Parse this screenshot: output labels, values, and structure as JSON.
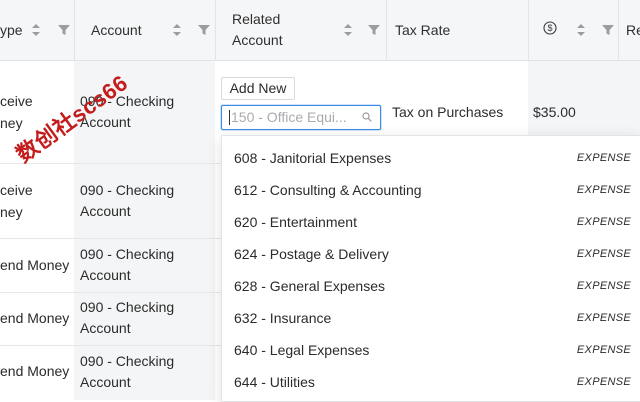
{
  "header": {
    "columns": [
      {
        "label": "ype"
      },
      {
        "label": "Account"
      },
      {
        "label": "Related\nAccount"
      },
      {
        "label": "Tax Rate"
      },
      {
        "label": "$"
      },
      {
        "label": "Re"
      }
    ]
  },
  "rows": [
    {
      "type_line1": "ceive",
      "type_line2": "ney",
      "account": "090 - Checking\nAccount",
      "tax": "Tax on Purchases",
      "amount": "$35.00"
    },
    {
      "type_line1": "ceive",
      "type_line2": "ney",
      "account": "090 - Checking\nAccount"
    },
    {
      "type": "end Money",
      "account": "090 - Checking\nAccount"
    },
    {
      "type": "end Money",
      "account": "090 - Checking\nAccount"
    },
    {
      "type": "end Money",
      "account": "090 - Checking\nAccount"
    }
  ],
  "editor": {
    "add_new_label": "Add New",
    "combo_placeholder": "150 - Office Equi..."
  },
  "dropdown": {
    "options": [
      {
        "name": "608 - Janitorial Expenses",
        "type": "EXPENSE"
      },
      {
        "name": "612 - Consulting & Accounting",
        "type": "EXPENSE"
      },
      {
        "name": "620 - Entertainment",
        "type": "EXPENSE"
      },
      {
        "name": "624 - Postage & Delivery",
        "type": "EXPENSE"
      },
      {
        "name": "628 - General Expenses",
        "type": "EXPENSE"
      },
      {
        "name": "632 - Insurance",
        "type": "EXPENSE"
      },
      {
        "name": "640 - Legal Expenses",
        "type": "EXPENSE"
      },
      {
        "name": "644 - Utilities",
        "type": "EXPENSE"
      }
    ]
  },
  "watermark": {
    "text": "数创社scs66"
  },
  "icons": {
    "sort": "sort-updown-icon",
    "filter": "filter-funnel-icon",
    "currency": "dollar-circle-icon",
    "search": "search-icon"
  },
  "colors": {
    "focus_border": "#3a8be8",
    "watermark": "#c41c1c",
    "header_bg": "#f5f6f7"
  }
}
